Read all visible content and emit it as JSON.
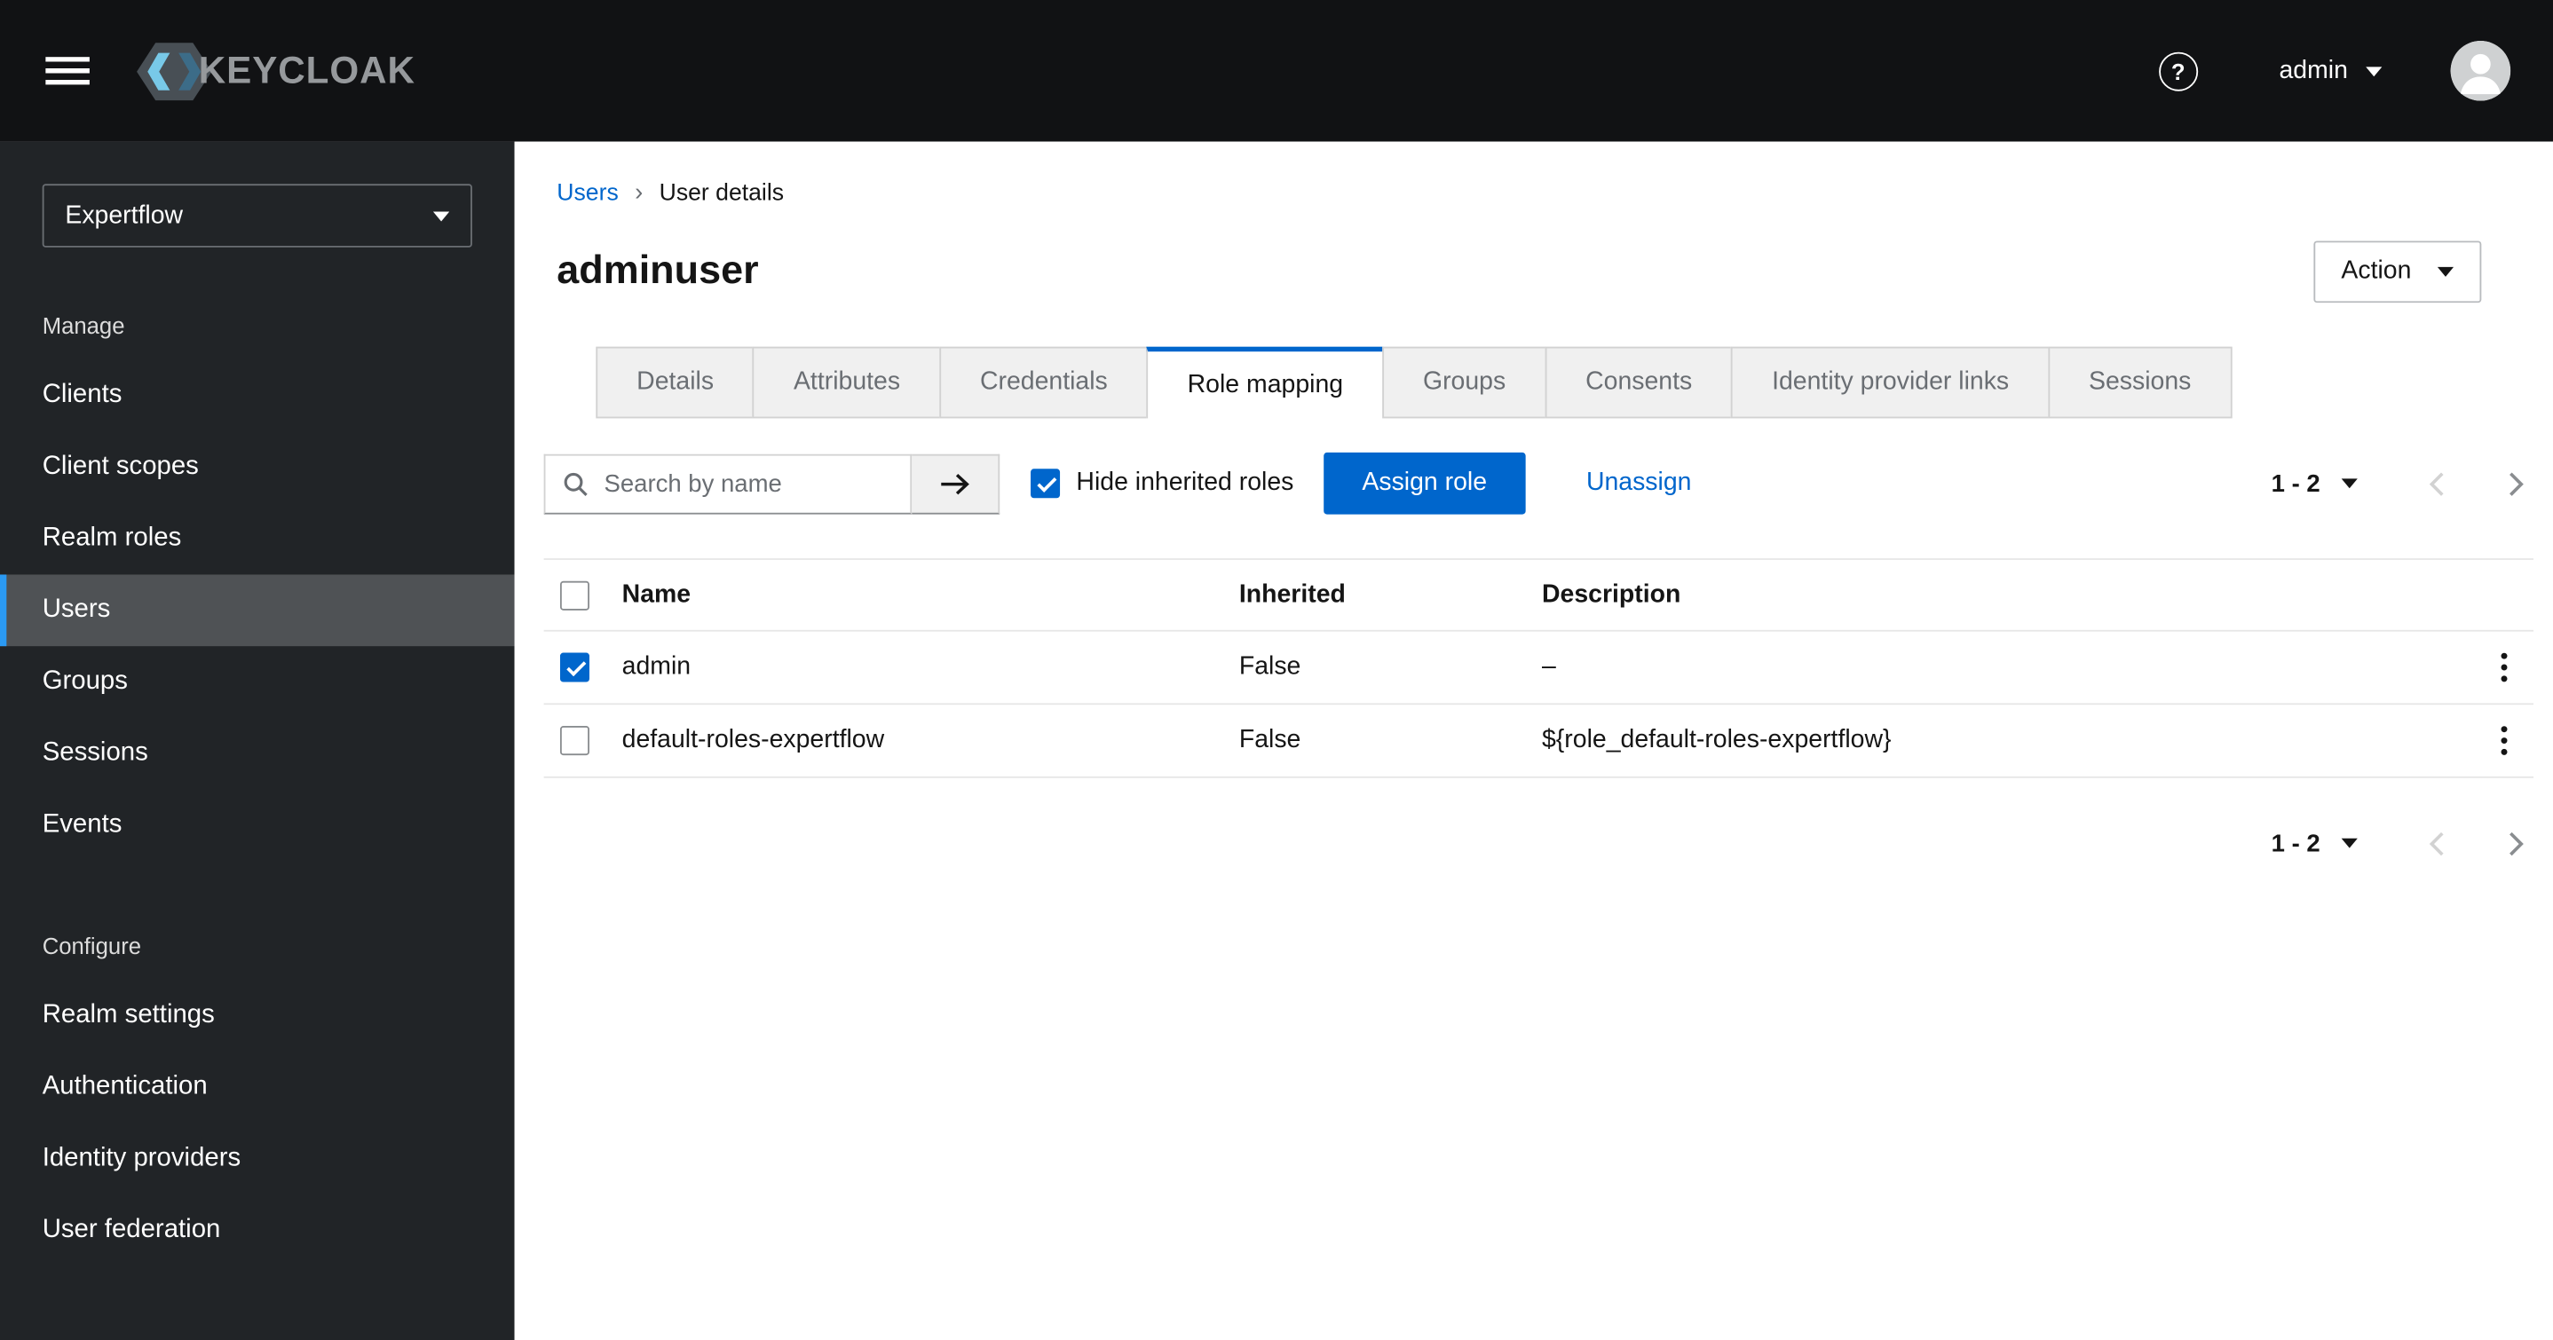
{
  "colors": {
    "accent": "#0066cc",
    "masthead_bg": "#111214",
    "sidebar_bg": "#212427",
    "nav_current_accent": "#2b9af3",
    "link": "#0066cc"
  },
  "icons": {
    "help": "?",
    "breadcrumb_separator": "›"
  },
  "header": {
    "brand": "KEYCLOAK",
    "username": "admin"
  },
  "sidebar": {
    "realm": "Expertflow",
    "sections": [
      {
        "title": "Manage",
        "items": [
          {
            "label": "Clients",
            "current": false
          },
          {
            "label": "Client scopes",
            "current": false
          },
          {
            "label": "Realm roles",
            "current": false
          },
          {
            "label": "Users",
            "current": true
          },
          {
            "label": "Groups",
            "current": false
          },
          {
            "label": "Sessions",
            "current": false
          },
          {
            "label": "Events",
            "current": false
          }
        ]
      },
      {
        "title": "Configure",
        "items": [
          {
            "label": "Realm settings",
            "current": false
          },
          {
            "label": "Authentication",
            "current": false
          },
          {
            "label": "Identity providers",
            "current": false
          },
          {
            "label": "User federation",
            "current": false
          }
        ]
      }
    ]
  },
  "breadcrumb": [
    {
      "label": "Users"
    },
    {
      "label": "User details"
    }
  ],
  "page": {
    "title": "adminuser",
    "action_button": "Action"
  },
  "tabs": [
    {
      "label": "Details",
      "active": false
    },
    {
      "label": "Attributes",
      "active": false
    },
    {
      "label": "Credentials",
      "active": false
    },
    {
      "label": "Role mapping",
      "active": true
    },
    {
      "label": "Groups",
      "active": false
    },
    {
      "label": "Consents",
      "active": false
    },
    {
      "label": "Identity provider links",
      "active": false
    },
    {
      "label": "Sessions",
      "active": false
    }
  ],
  "toolbar": {
    "search_placeholder": "Search by name",
    "hide_inherited_label": "Hide inherited roles",
    "hide_inherited_checked": true,
    "assign_role_label": "Assign role",
    "unassign_label": "Unassign",
    "pagination_range": "1 - 2"
  },
  "table": {
    "select_all_checked": false,
    "columns": [
      "Name",
      "Inherited",
      "Description"
    ],
    "rows": [
      {
        "checked": true,
        "name": "admin",
        "inherited": "False",
        "description": "–"
      },
      {
        "checked": false,
        "name": "default-roles-expertflow",
        "inherited": "False",
        "description": "${role_default-roles-expertflow}"
      }
    ]
  },
  "footer": {
    "pagination_range": "1 - 2"
  }
}
